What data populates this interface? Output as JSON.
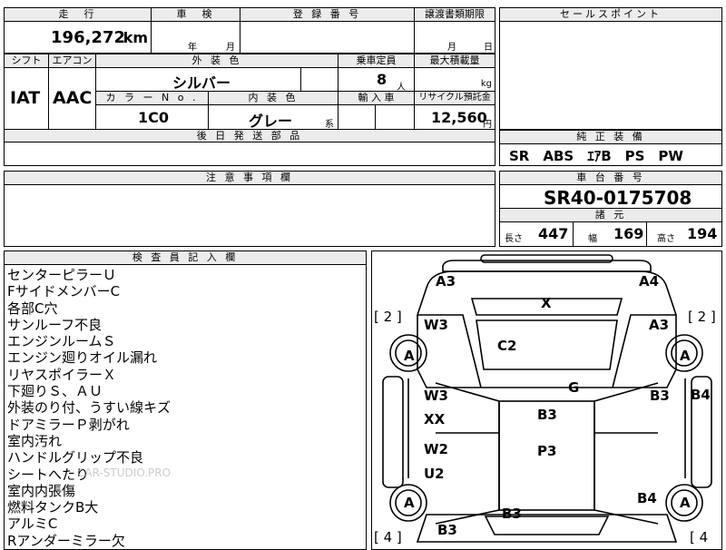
{
  "top": {
    "mileage_label": "走　行",
    "mileage_value": "196,272",
    "mileage_unit": "km",
    "inspection_label": "車　検",
    "inspection_year": "年",
    "inspection_month": "月",
    "registration_label": "登 録 番 号",
    "transfer_label": "譲渡書類期限",
    "transfer_month": "月",
    "transfer_day": "日"
  },
  "spec": {
    "shift_label": "シフト",
    "shift_value": "IAT",
    "aircon_label": "エアコン",
    "aircon_value": "AAC",
    "exterior_label": "外 装 色",
    "exterior_value": "シルバー",
    "capacity_label": "乗車定員",
    "capacity_value": "8",
    "capacity_unit": "人",
    "maxload_label": "最大積載量",
    "maxload_unit": "kg",
    "color_no_label": "カ ラ ー N o .",
    "color_no_value": "1C0",
    "interior_label": "内 装 色",
    "interior_value": "グレー",
    "interior_suffix": "系",
    "import_label": "輸 入 車",
    "recycle_label": "リサイクル預託金",
    "recycle_value": "12,560",
    "recycle_unit": "円",
    "later_parts_label": "後 日 発 送 部 品"
  },
  "sales": {
    "header": "セールスポイント"
  },
  "equipment": {
    "header": "純 正 装 備",
    "value": "SR　ABS　ｴｱB　PS　PW"
  },
  "caution": {
    "header": "注 意 事 項 欄"
  },
  "chassis": {
    "header": "車 台 番 号",
    "value": "SR40-0175708",
    "dims_header": "諸 元",
    "length_label": "長さ",
    "length_value": "447",
    "width_label": "幅",
    "width_value": "169",
    "height_label": "高さ",
    "height_value": "194"
  },
  "inspector": {
    "header": "検 査 員 記 入 欄",
    "notes": [
      "センターピラーＵ",
      "FサイドメンバーC",
      "各部C穴",
      "サンルーフ不良",
      "エンジンルームＳ",
      "エンジン廻りオイル漏れ",
      "リヤスポイラーＸ",
      "下廻りＳ、ＡＵ",
      "外装のり付、うすい線キズ",
      "ドアミラーＰ剥がれ",
      "室内汚れ",
      "ハンドルグリップ不良",
      "シートへたり",
      "室内内張傷",
      "燃料タンクB大",
      "アルミC",
      "Rアンダーミラー欠"
    ]
  },
  "watermark": "CAR-STUDIO.PRO",
  "diagram": {
    "marks": {
      "a3_left": "A3",
      "a4_right": "A4",
      "x_roof": "X",
      "bracket_left_top": "[ 2 ]",
      "bracket_right_top": "[ 2 ]",
      "w3_left": "W3",
      "a3_right": "A3",
      "a_front_left": "A",
      "a_front_right": "A",
      "c2": "C2",
      "g": "G",
      "w3_mid": "W3",
      "xx": "XX",
      "b3_mid": "B3",
      "b3_right": "B3",
      "b4_right": "B4",
      "w2": "W2",
      "u2": "U2",
      "p3": "P3",
      "b4_rear": "B4",
      "a_rear_left": "A",
      "a_rear_right": "A",
      "b3_bottom": "B3",
      "b3_bottom_left": "B3",
      "bracket_left_bottom": "[ 4 ]",
      "bracket_right_bottom": "[ 4"
    }
  }
}
